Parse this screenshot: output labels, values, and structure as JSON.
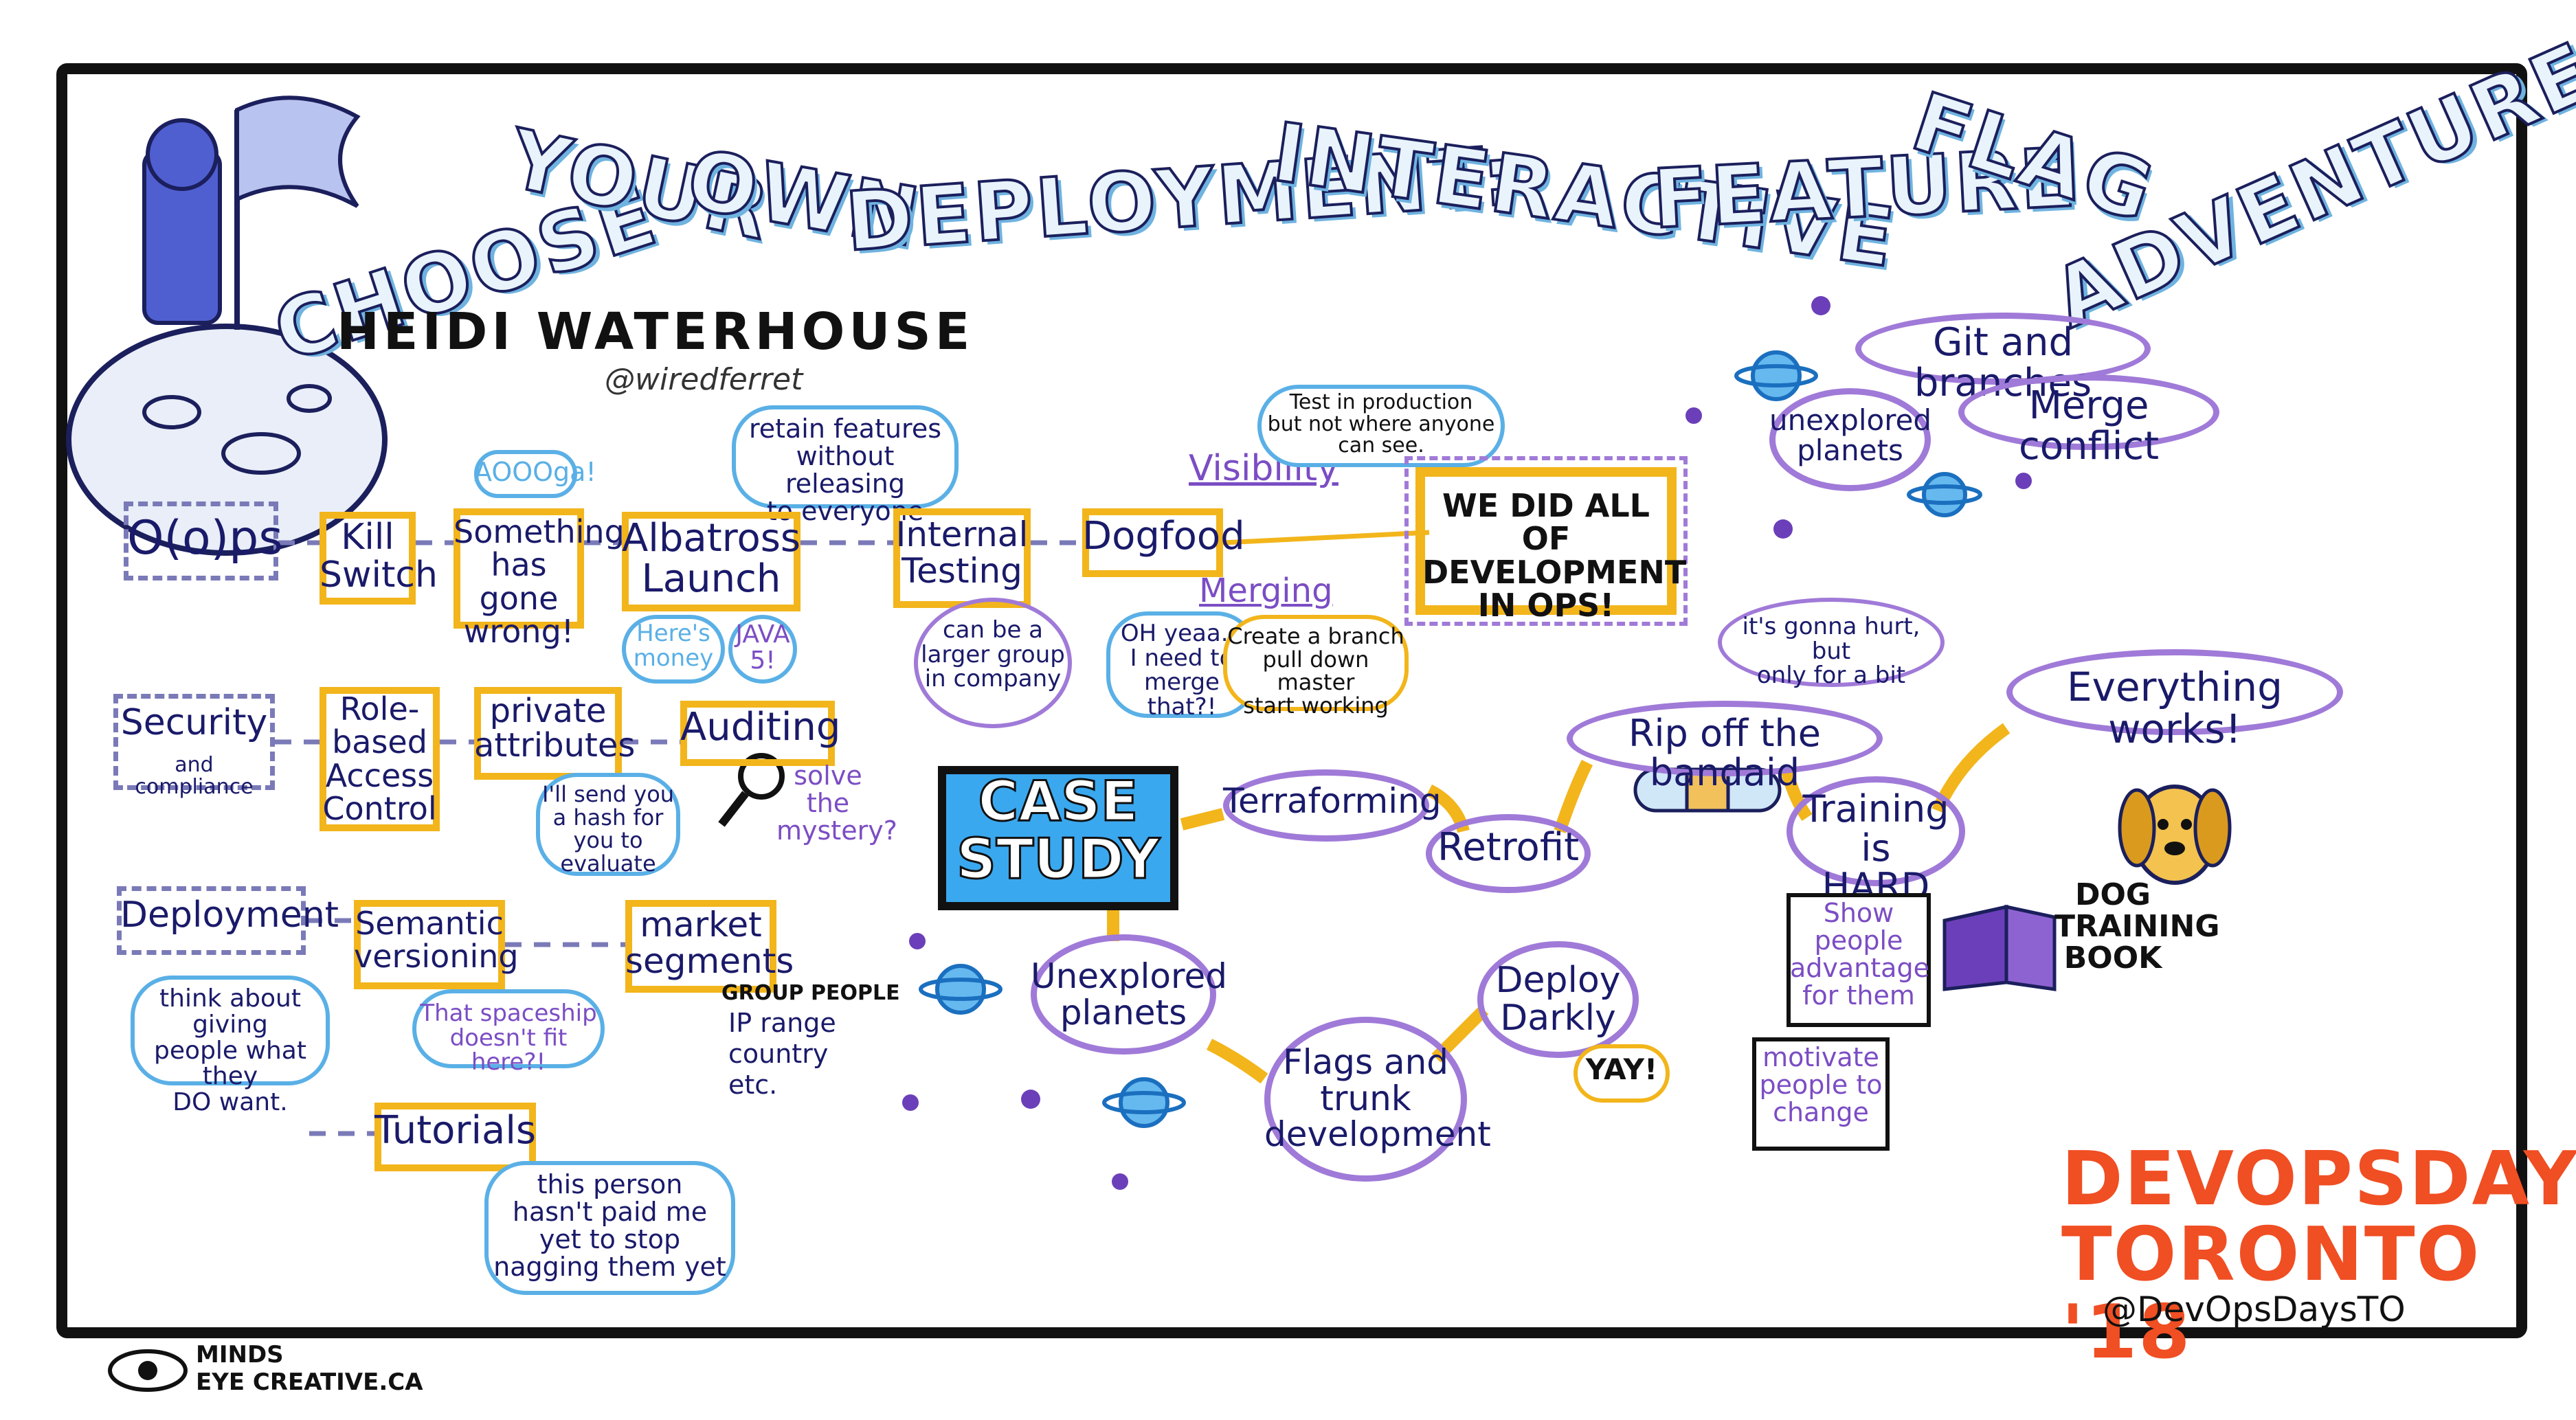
{
  "title": {
    "words": [
      "CHOOSE",
      "YOUR",
      "OWN",
      "DEPLOYMENT:",
      "INTERACTIVE",
      "FEATURE",
      "FLAG",
      "ADVENTURE"
    ]
  },
  "speaker": {
    "name": "HEIDI WATERHOUSE",
    "handle": "@wiredferret"
  },
  "row1": {
    "oops": "O(o)ps",
    "kill_switch": "Kill\nSwitch",
    "something_wrong": "Something\nhas gone\nwrong!",
    "aooga": "AOOOga!",
    "albatross": "Albatross\nLaunch",
    "retain_note": "retain features\nwithout releasing\nto everyone",
    "heres_money": "Here's\nmoney",
    "java": "JAVA\n5!",
    "internal_testing": "Internal\nTesting",
    "larger_group": "can be a\nlarger group\nin company",
    "dogfood": "Dogfood",
    "visibility": "Visibility",
    "test_in_prod": "Test in production\nbut not where anyone\ncan see.",
    "merging": "Merging",
    "oh_yeah": "OH yeaa...\nI need to\nmerge that?!",
    "create_branch": "Create a branch\npull down master\nstart working",
    "we_did_all": "WE DID ALL OF\nDEVELOPMENT\nIN OPS!"
  },
  "row2": {
    "security": "Security",
    "security_sub": "and compliance",
    "rbac": "Role-\nbased\nAccess\nControl",
    "private_attrs": "private\nattributes",
    "hash_note": "I'll send you\na hash for\nyou to evaluate",
    "auditing": "Auditing",
    "solve": "solve\nthe\nmystery?"
  },
  "row3": {
    "deployment": "Deployment",
    "think_about": "think about giving\npeople what they\nDO want.",
    "semantic": "Semantic\nversioning",
    "spaceship": "That spaceship\ndoesn't fit here?!",
    "market": "market\nsegments",
    "group_people": "GROUP PEOPLE",
    "ip_range": "IP range",
    "country": "country",
    "etc": "etc.",
    "tutorials": "Tutorials",
    "tutorials_note": "this person\nhasn't paid me\nyet to stop\nnagging them yet"
  },
  "case_study": {
    "label": "CASE\nSTUDY",
    "terraforming": "Terraforming",
    "retrofit": "Retrofit",
    "rip_off": "Rip off the bandaid",
    "gonna_hurt": "it's gonna hurt, but\nonly for a bit",
    "everything_works": "Everything works!",
    "training_hard": "Training is\nHARD",
    "show_people": "Show\npeople\nadvantage\nfor them",
    "motivate": "motivate\npeople to\nchange",
    "dog_book": "DOG\nTRAINING\nBOOK",
    "unexplored": "Unexplored\nplanets",
    "flags_trunk": "Flags and\ntrunk\ndevelopment",
    "deploy_darkly": "Deploy\nDarkly",
    "yay": "YAY!"
  },
  "top_right": {
    "git_branches": "Git and branches",
    "merge_conflict": "Merge conflict",
    "unexplored": "unexplored\nplanets"
  },
  "event": {
    "line1": "DEVOPSDAYS",
    "line2": "TORONTO '18",
    "handle": "@DevOpsDaysTO"
  },
  "credit": {
    "line1": "MINDS",
    "line2": "EYE CREATIVE.CA"
  },
  "colors": {
    "ink": "#1a1a6a",
    "yellow": "#f2b51b",
    "purple": "#a07ad8",
    "blue": "#5ab0e6",
    "orange_red": "#f04e23"
  }
}
